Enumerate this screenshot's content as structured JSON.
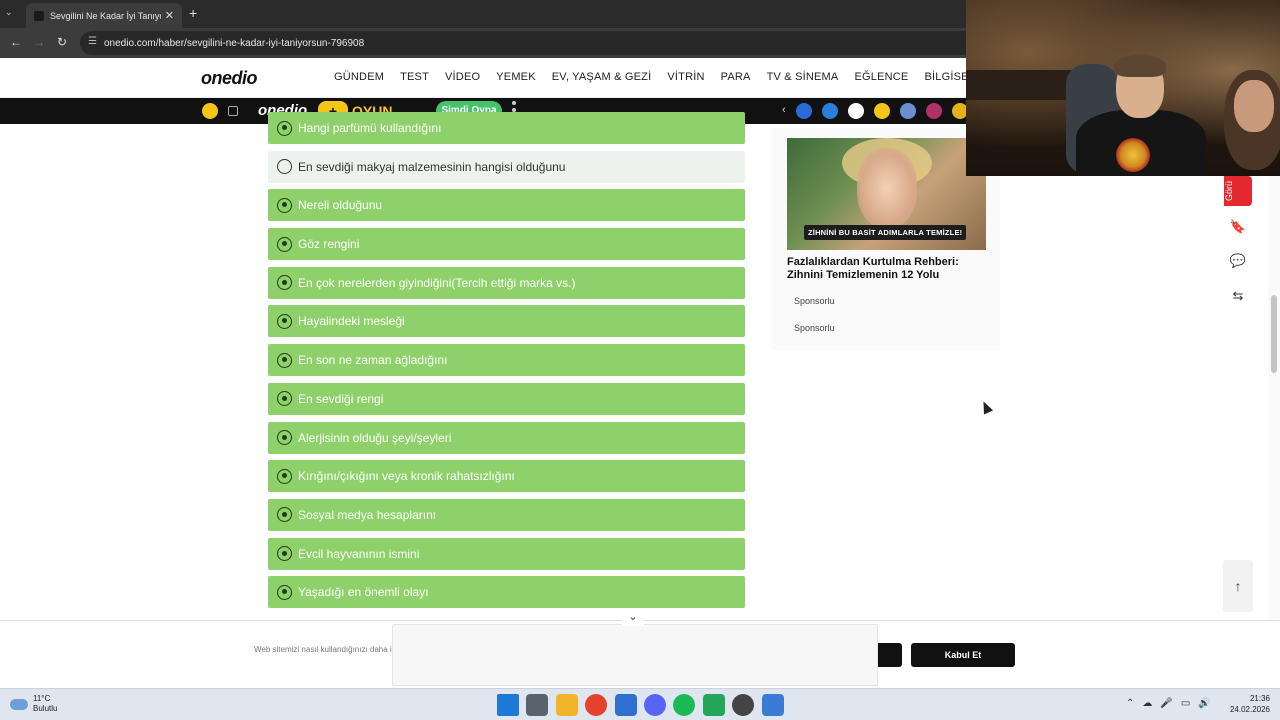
{
  "browser": {
    "tab_title": "Sevgilini Ne Kadar İyi Tanıyorsun",
    "tab_close": "✕",
    "new_tab": "+",
    "menu_chevron": "⌄",
    "back": "←",
    "forward": "→",
    "reload": "↻",
    "url": "onedio.com/haber/sevgilini-ne-kadar-iyi-taniyorsun-796908"
  },
  "site": {
    "logo": "onedio",
    "nav": [
      "GÜNDEM",
      "TEST",
      "VİDEO",
      "YEMEK",
      "EV, YAŞAM & GEZİ",
      "VİTRİN",
      "PARA",
      "TV & SİNEMA",
      "EĞLENCE",
      "BİLGİSEL"
    ]
  },
  "gamebar": {
    "logo": "onedio",
    "plus": "+",
    "oyun": "OYUN",
    "play_button": "Şimdi Oyna",
    "prev_arrow": "‹",
    "game_colors": [
      "#2a6bd8",
      "#2a7fd8",
      "#ffffff",
      "#f5c518",
      "#6b8fd1",
      "#b0306a",
      "#e3b21a"
    ]
  },
  "quiz": {
    "options": [
      {
        "label": "Hangi parfümü kullandığını",
        "selected": true
      },
      {
        "label": "En sevdiği makyaj malzemesinin hangisi olduğunu",
        "selected": false
      },
      {
        "label": "Nereli olduğunu",
        "selected": true
      },
      {
        "label": "Göz rengini",
        "selected": true
      },
      {
        "label": "En çok nerelerden giyindiğini(Tercih ettiği marka vs.)",
        "selected": true
      },
      {
        "label": "Hayalindeki mesleği",
        "selected": true
      },
      {
        "label": "En son ne zaman ağladığını",
        "selected": true
      },
      {
        "label": "En sevdiği rengi",
        "selected": true
      },
      {
        "label": "Alerjisinin olduğu şeyi/şeyleri",
        "selected": true
      },
      {
        "label": "Kırığını/çıkığını veya kronik rahatsızlığını",
        "selected": true
      },
      {
        "label": "Sosyal medya hesaplarını",
        "selected": true
      },
      {
        "label": "Evcil hayvanının ismini",
        "selected": true
      },
      {
        "label": "Yaşadığı en önemli olayı",
        "selected": true
      }
    ]
  },
  "ad": {
    "badge": "ZİHNİNİ BU BASİT ADIMLARLA TEMİZLE!",
    "title": "Fazlalıklardan Kurtulma Rehberi: Zihnini Temizlemenin 12 Yolu",
    "sponsor1": "Sponsorlu",
    "sponsor2": "Sponsorlu"
  },
  "side_tools": {
    "feedback_label": "Görü",
    "bookmark_icon": "🔖",
    "comment_icon": "💬",
    "share_icon": "⇆",
    "to_top_icon": "↑"
  },
  "cookie": {
    "text": "Web sitemizi nasıl kullandığınızı daha iyi anlamak için çerezler kullanıyoruz. Detaylı bilgi için",
    "accept_label": "Kabul Et",
    "popover_chevron": "⌄"
  },
  "taskbar": {
    "weather_temp": "11°C",
    "weather_desc": "Bulutlu",
    "time": "21:36",
    "date": "24.02.2026",
    "app_colors": [
      "#1e78d7",
      "#5a6270",
      "#f2b52a",
      "#e2432a",
      "#2f6fd0",
      "#5865f2",
      "#1db954",
      "#23a55a",
      "#444444",
      "#3a7bd5"
    ],
    "tray_icons": [
      "⌃",
      "☁",
      "🎤",
      "▭",
      "🔊"
    ]
  }
}
